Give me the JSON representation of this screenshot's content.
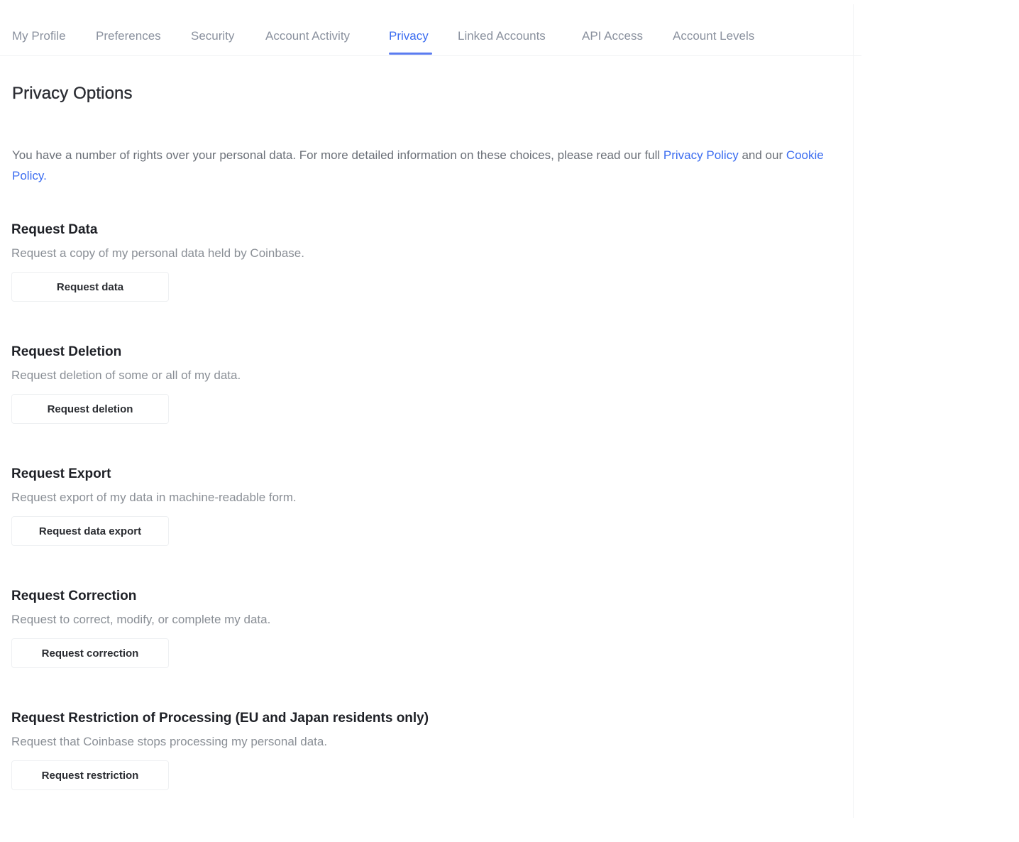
{
  "tabs": [
    {
      "label": "My Profile",
      "active": false
    },
    {
      "label": "Preferences",
      "active": false
    },
    {
      "label": "Security",
      "active": false
    },
    {
      "label": "Account Activity",
      "active": false
    },
    {
      "label": "Privacy",
      "active": true
    },
    {
      "label": "Linked Accounts",
      "active": false
    },
    {
      "label": "API Access",
      "active": false
    },
    {
      "label": "Account Levels",
      "active": false
    }
  ],
  "colors": {
    "accent": "#3b6cf0",
    "tab_inactive": "#8a919e",
    "body_text": "#6b7078",
    "heading": "#1e2026"
  },
  "page": {
    "title": "Privacy Options",
    "intro_before": "You have a number of rights over your personal data. For more detailed information on these choices, please read our full ",
    "privacy_policy_link": "Privacy Policy",
    "intro_middle": " and our ",
    "cookie_policy_link": "Cookie Policy",
    "intro_after": "."
  },
  "sections": [
    {
      "title": "Request Data",
      "description": "Request a copy of my personal data held by Coinbase.",
      "button": "Request data"
    },
    {
      "title": "Request Deletion",
      "description": "Request deletion of some or all of my data.",
      "button": "Request deletion"
    },
    {
      "title": "Request Export",
      "description": "Request export of my data in machine-readable form.",
      "button": "Request data export"
    },
    {
      "title": "Request Correction",
      "description": "Request to correct, modify, or complete my data.",
      "button": "Request correction"
    },
    {
      "title": "Request Restriction of Processing (EU and Japan residents only)",
      "description": "Request that Coinbase stops processing my personal data.",
      "button": "Request restriction"
    }
  ]
}
